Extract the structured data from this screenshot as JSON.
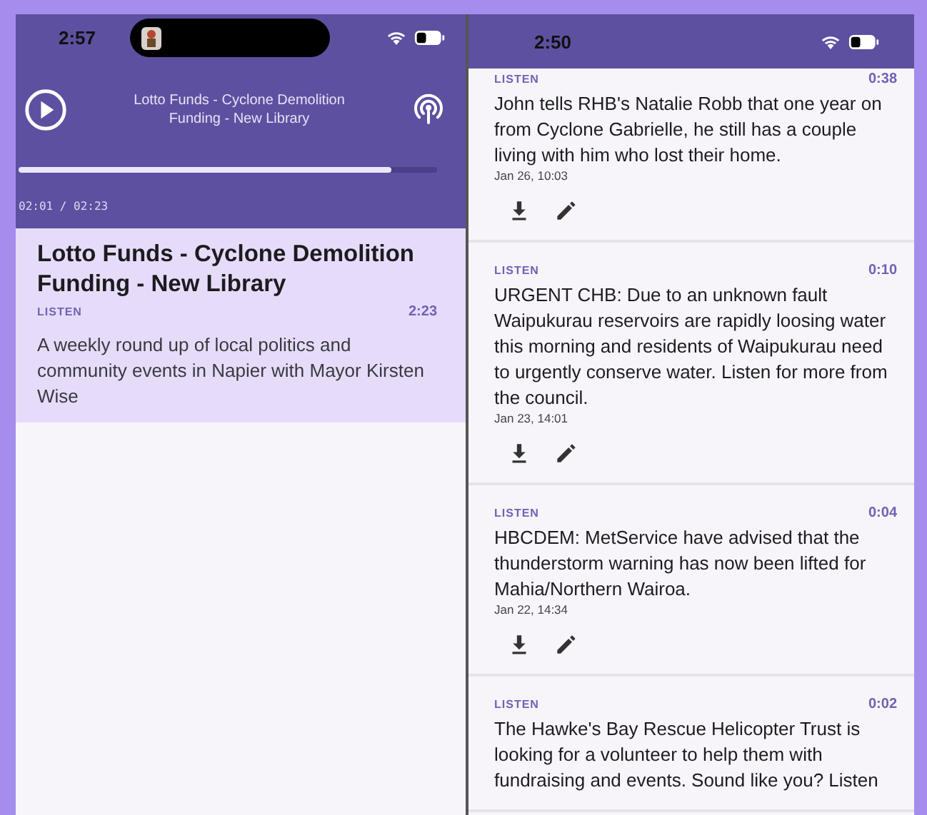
{
  "left_screen": {
    "status_bar": {
      "time": "2:57"
    },
    "player": {
      "title": "Lotto Funds - Cyclone Demolition Funding - New Library",
      "progress": {
        "level": 0.89
      },
      "elapsed": "02:01 / 02:23"
    },
    "episode": {
      "title": "Lotto Funds - Cyclone Demolition Funding - New Library",
      "action": "LISTEN",
      "duration": "2:23",
      "description": "A weekly round up of local politics and community events in Napier with Mayor Kirsten Wise"
    }
  },
  "right_screen": {
    "status_bar": {
      "time": "2:50"
    },
    "items": [
      {
        "action": "LISTEN",
        "duration": "0:38",
        "text": "John tells RHB's Natalie Robb that one year on from Cyclone Gabrielle, he still has a couple living with him who lost their home.",
        "date": "Jan 26, 10:03"
      },
      {
        "action": "LISTEN",
        "duration": "0:10",
        "text": "URGENT CHB: Due to an unknown fault Waipukurau reservoirs are rapidly loosing water this morning and residents of Waipukurau need to urgently conserve water. Listen for more from the council.",
        "date": "Jan 23, 14:01"
      },
      {
        "action": "LISTEN",
        "duration": "0:04",
        "text": "HBCDEM: MetService have advised that the thunderstorm warning has now been lifted for Mahia/Northern Wairoa.",
        "date": "Jan 22, 14:34"
      },
      {
        "action": "LISTEN",
        "duration": "0:02",
        "text": "The Hawke's Bay Rescue Helicopter Trust is looking for a volunteer to help them with fundraising and events. Sound like you? Listen"
      }
    ]
  }
}
